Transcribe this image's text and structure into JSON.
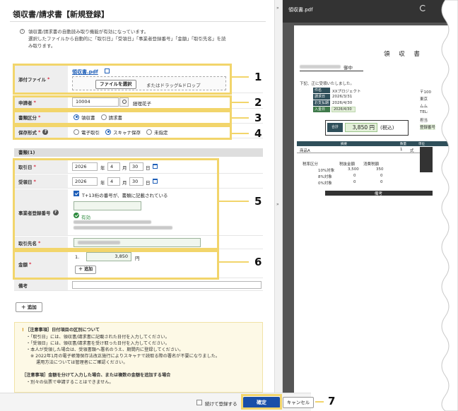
{
  "page": {
    "title": "領収書/請求書【新規登録】",
    "info_line1": "領収書/請求書の自動読み取り機能が有効になっています。",
    "info_line2": "選択したファイルから自動的に「取引日」「受領日」「事業者登録番号」「金額」「取引先名」を読",
    "info_line3": "み取ります。"
  },
  "form": {
    "attachment": {
      "label": "添付ファイル",
      "file_name": "領収書.pdf",
      "select_button": "ファイルを選択",
      "drop_text": "またはドラッグ&ドロップ"
    },
    "applicant": {
      "label": "申請者",
      "code": "10004",
      "name": "経理花子"
    },
    "doc_type": {
      "label": "書類区分",
      "options": [
        "領収書",
        "請求書"
      ],
      "selected": "領収書"
    },
    "storage": {
      "label": "保存形式",
      "options": [
        "電子取引",
        "スキャナ保存",
        "未指定"
      ],
      "selected": "スキャナ保存"
    },
    "section_title": "書類(1)",
    "transaction_date": {
      "label": "取引日",
      "year": "2026",
      "month": "4",
      "day": "30",
      "unit_year": "年",
      "unit_month": "月",
      "unit_day": "日"
    },
    "receipt_date": {
      "label": "受領日",
      "year": "2026",
      "month": "4",
      "day": "30",
      "unit_year": "年",
      "unit_month": "月",
      "unit_day": "日"
    },
    "registration": {
      "label": "事業者登録番号",
      "checkbox_text": "T+13桁の番号が、書類に記載されている",
      "status": "有効"
    },
    "partner": {
      "label": "取引先名"
    },
    "amount": {
      "label": "金額",
      "index": "1.",
      "value": "3,850",
      "unit": "円",
      "add_label": "追加"
    },
    "remarks": {
      "label": "備考"
    },
    "add_button": "追加"
  },
  "notice": {
    "head1": "［注意事項］日付項目の区別について",
    "l1": "・「取引日」には、領収書/請求書に記載された日付を入力してください。",
    "l2": "・「受領日」には、領収書/請求書を受け取った日付を入力してください。",
    "l3": "・本人が受領した場合は、受領書類へ署名のうえ、期間内に登録してください。",
    "l4": "※ 2022年1月の電子帳簿保存法改正施行によりスキャナで読取る際の署名が不要になりました。",
    "l5": "運用方法については管理者にご確認ください。",
    "head2": "［注意事項］金額を分けて入力した場合、または複数の金額を追加する場合",
    "l6": "・別々の伝票で申請することはできません。"
  },
  "footer": {
    "continue_label": "続けて登録する",
    "confirm": "確定",
    "cancel": "キャンセル"
  },
  "callouts": [
    "1",
    "2",
    "3",
    "4",
    "5",
    "6",
    "7"
  ],
  "preview": {
    "file_name": "領収書.pdf",
    "doc_title": "領 収 書",
    "recipient_suffix": "御中",
    "greeting": "下記、正に受領いたしました。",
    "rows": [
      {
        "tag": "件名",
        "value": "XXプロジェクト"
      },
      {
        "tag": "請求日",
        "value": "2026/3/31"
      },
      {
        "tag": "お支払期限",
        "value": "2026/4/30"
      },
      {
        "tag": "入金日",
        "value": "2026/4/30"
      }
    ],
    "amount_label": "合計",
    "amount_value": "3,850 円",
    "amount_tax": "(税込)",
    "table_headers": [
      "摘要",
      "数量",
      "単位"
    ],
    "item_name": "商品A",
    "item_qty": "1",
    "item_unit": "式",
    "tax_headers": [
      "税率区分",
      "税抜金額",
      "消費税額"
    ],
    "tax_rows": [
      {
        "rate": "10%対象",
        "net": "3,500",
        "tax": "350"
      },
      {
        "rate": "8%対象",
        "net": "0",
        "tax": "0"
      },
      {
        "rate": "0%対象",
        "net": "0",
        "tax": "0"
      }
    ],
    "remarks_label": "備考",
    "issuer_lines": [
      "〒100",
      "東京",
      "ムム",
      "TEL:",
      "担当",
      "登録番号"
    ]
  },
  "colors": {
    "accent": "#1a4fa8",
    "highlight": "#f2d56b",
    "header_dark": "#2f4f5a"
  }
}
